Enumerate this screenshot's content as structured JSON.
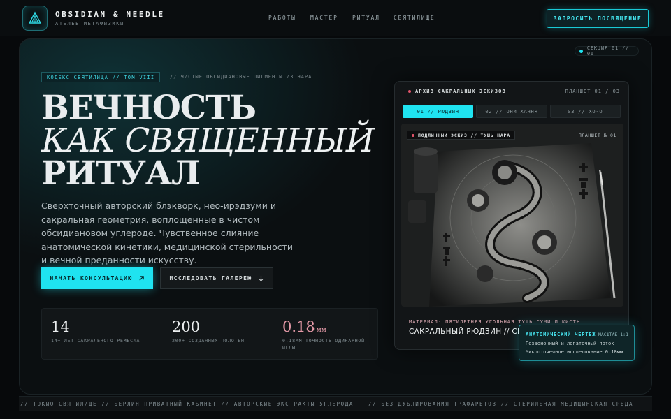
{
  "brand": {
    "name": "OBSIDIAN & NEEDLE",
    "subtitle": "АТЕЛЬЕ МЕТАФИЗИКИ"
  },
  "nav": [
    {
      "label": "РАБОТЫ"
    },
    {
      "label": "МАСТЕР"
    },
    {
      "label": "РИТУАЛ"
    },
    {
      "label": "СВЯТИЛИЩЕ"
    }
  ],
  "header_cta": "ЗАПРОСИТЬ ПОСВЯЩЕНИЕ",
  "section_badge": "СЕКЦИЯ 01 // 06",
  "hero": {
    "codex_tag": "КОДЕКС СВЯТИЛИЩА // ТОМ VIII",
    "codex_note": "// ЧИСТЫЕ ОБСИДИАНОВЫЕ ПИГМЕНТЫ ИЗ НАРА",
    "title_line1": "ВЕЧНОСТЬ",
    "title_line2": "КАК СВЯЩЕННЫЙ",
    "title_line3": "РИТУАЛ",
    "lead": "Сверхточный авторский блэкворк, нео-ирэдзуми и сакральная геометрия, воплощенные в чистом обсидиановом углероде. Чувственное слияние анатомической кинетики, медицинской стерильности и вечной преданности искусству.",
    "primary_button": "НАЧАТЬ КОНСУЛЬТАЦИЮ",
    "secondary_button": "ИССЛЕДОВАТЬ ГАЛЕРЕЮ"
  },
  "stats": [
    {
      "value": "14",
      "unit": "",
      "label": "14+ ЛЕТ САКРАЛЬНОГО РЕМЕСЛА"
    },
    {
      "value": "200",
      "unit": "",
      "label": "200+ СОЗДАННЫХ ПОЛОТЕН"
    },
    {
      "value": "0.18",
      "unit": "мм",
      "label": "0.18ММ ТОЧНОСТЬ ОДИНАРНОЙ ИГЛЫ"
    }
  ],
  "archive": {
    "title": "АРХИВ САКРАЛЬНЫХ ЭСКИЗОВ",
    "sheet": "ПЛАНШЕТ 01 / 03",
    "tabs": [
      {
        "label": "01 // РЮДЗИН",
        "active": true
      },
      {
        "label": "02 // ОНИ ХАННЯ",
        "active": false
      },
      {
        "label": "03 // ХО-О",
        "active": false
      }
    ],
    "image_badge": "ПОДЛИННЫЙ ЭСКИЗ // ТУШЬ НАРА",
    "image_plate": "ПЛАНШЕТ № 01",
    "image_alt": "dragon-sketch-image",
    "material": "МАТЕРИАЛ: ПЯТИЛЕТНЯЯ УГОЛЬНАЯ ТУШЬ СУМИ И КИСТЬ",
    "caption": "САКРАЛЬНЫЙ РЮДЗИН // СПИНА"
  },
  "anatomy_card": {
    "title": "АНАТОМИЧЕСКИЙ ЧЕРТЕЖ",
    "scale": "МАСШТАБ 1:1",
    "line1": "Позвоночный и лопаточный поток",
    "line2": "Микроточечное исследование 0.18мм"
  },
  "ticker": {
    "left": "// ТОКИО СВЯТИЛИЩЕ // БЕРЛИН ПРИВАТНЫЙ КАБИНЕТ // АВТОРСКИЕ ЭКСТРАКТЫ УГЛЕРОДА",
    "right": "// БЕЗ ДУБЛИРОВАНИЯ ТРАФАРЕТОВ // СТЕРИЛЬНАЯ МЕДИЦИНСКАЯ СРЕДА"
  },
  "colors": {
    "accent": "#1fe3f0",
    "rose": "#e59aa8",
    "background": "#07090b"
  }
}
